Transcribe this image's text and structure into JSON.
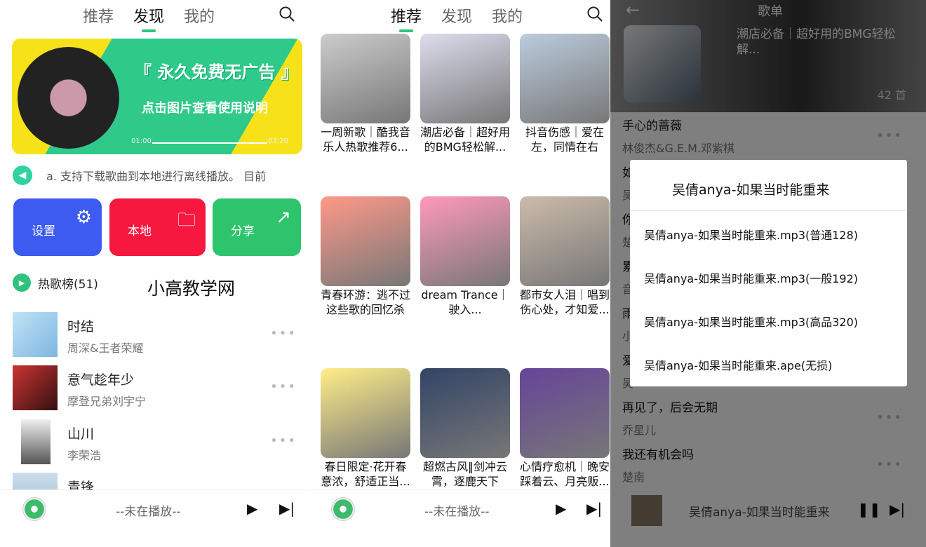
{
  "screen1": {
    "tabs": [
      "推荐",
      "发现",
      "我的"
    ],
    "active_tab": 1,
    "banner": {
      "title": "『 永久免费无广告 』",
      "subtitle": "点击图片查看使用说明",
      "time_start": "01:00",
      "time_end": "03:20"
    },
    "notice": "a. 支持下载歌曲到本地进行离线播放。 目前",
    "quick_actions": [
      {
        "label": "设置",
        "icon": "gear-icon",
        "color": "#3d5af1"
      },
      {
        "label": "本地",
        "icon": "folder-icon",
        "color": "#f7183f"
      },
      {
        "label": "分享",
        "icon": "share-icon",
        "color": "#2ec46e"
      }
    ],
    "hot_list_label": "热歌榜(51)",
    "watermark": "小高教学网",
    "songs": [
      {
        "title": "时结",
        "artist": "周深&王者荣耀"
      },
      {
        "title": "意气趁年少",
        "artist": "摩登兄弟刘宇宁"
      },
      {
        "title": "山川",
        "artist": "李荣浩"
      },
      {
        "title": "青锋",
        "artist": ""
      }
    ],
    "player": {
      "status": "--未在播放--"
    }
  },
  "screen2": {
    "tabs": [
      "推荐",
      "发现",
      "我的"
    ],
    "active_tab": 0,
    "playlists": [
      {
        "title": "一周新歌｜酷我音乐人热歌推荐6..."
      },
      {
        "title": "潮店必备｜超好用的BMG轻松解..."
      },
      {
        "title": "抖音伤感｜爱在左，同情在右"
      },
      {
        "title": "青春环游：逃不过这些歌的回忆杀"
      },
      {
        "title": "dream Trance｜驶入..."
      },
      {
        "title": "都市女人泪｜唱到伤心处，才知爱..."
      },
      {
        "title": "春日限定·花开春意浓，舒适正当..."
      },
      {
        "title": "超燃古风‖剑冲云霄，逐鹿天下"
      },
      {
        "title": "心情疗愈机｜晚安踩着云、月亮贩..."
      }
    ],
    "player": {
      "status": "--未在播放--"
    }
  },
  "screen3": {
    "header_title": "歌单",
    "playlist_title": "潮店必备｜超好用的BMG轻松解...",
    "song_count": "42 首",
    "songs": [
      {
        "title": "手心的蔷薇",
        "artist": "林俊杰&G.E.M.邓紫棋"
      },
      {
        "title": "如",
        "artist": "吴"
      },
      {
        "title": "你",
        "artist": "楚"
      },
      {
        "title": "累",
        "artist": "音"
      },
      {
        "title": "雨",
        "artist": "小"
      },
      {
        "title": "爱",
        "artist": "吴"
      },
      {
        "title": "再见了，后会无期",
        "artist": "乔星儿"
      },
      {
        "title": "我还有机会吗",
        "artist": "楚南"
      }
    ],
    "dialog": {
      "title": "吴倩anya-如果当时能重来",
      "options": [
        "吴倩anya-如果当时能重来.mp3(普通128)",
        "吴倩anya-如果当时能重来.mp3(一般192)",
        "吴倩anya-如果当时能重来.mp3(高品320)",
        "吴倩anya-如果当时能重来.ape(无损)"
      ]
    },
    "player": {
      "now_playing": "吴倩anya-如果当时能重来"
    }
  }
}
